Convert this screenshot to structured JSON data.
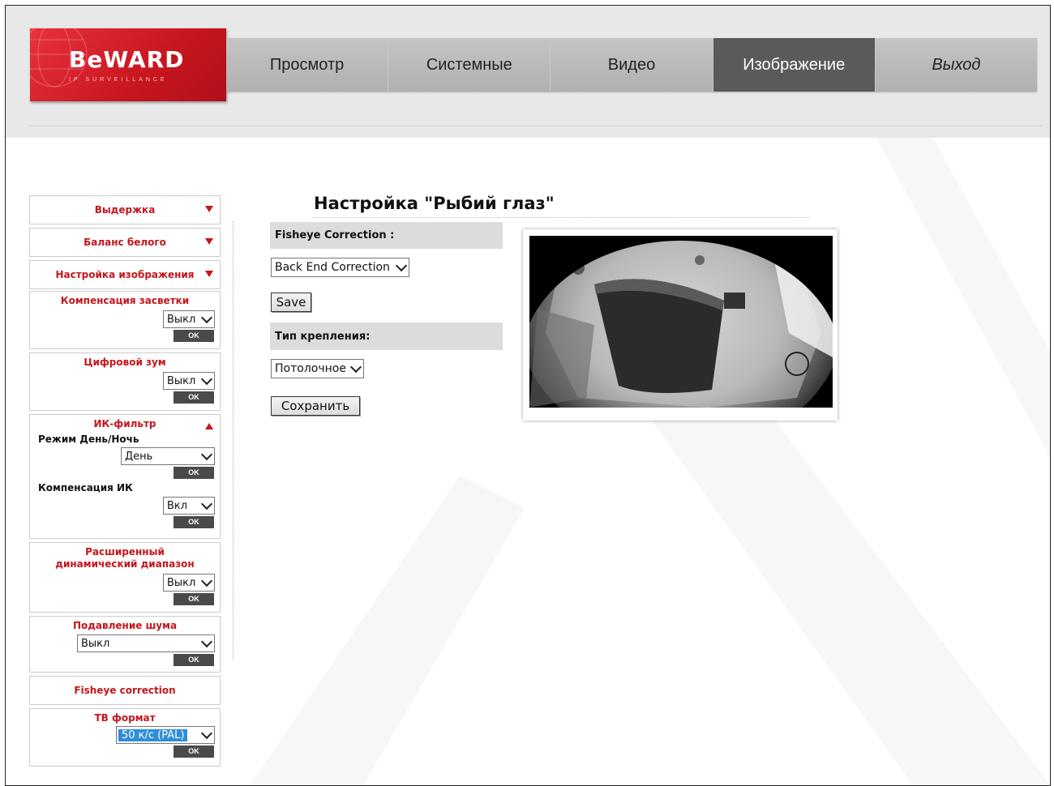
{
  "logo": {
    "brand": "BeWARD",
    "tagline": "IP SURVEILLANCE"
  },
  "nav": {
    "items": [
      {
        "label": "Просмотр",
        "active": false
      },
      {
        "label": "Системные",
        "active": false
      },
      {
        "label": "Видео",
        "active": false
      },
      {
        "label": "Изображение",
        "active": true
      },
      {
        "label": "Выход",
        "active": false
      }
    ]
  },
  "sidebar": {
    "exposure": "Выдержка",
    "white_balance": "Баланс белого",
    "image_settings": "Настройка изображения",
    "backlight": {
      "title": "Компенсация засветки",
      "value": "Выкл",
      "ok": "OK"
    },
    "digital_zoom": {
      "title": "Цифровой зум",
      "value": "Выкл",
      "ok": "OK"
    },
    "ir_filter": {
      "title": "ИК-фильтр",
      "day_night_label": "Режим День/Ночь",
      "day_night_value": "День",
      "ok1": "OK",
      "ir_comp_label": "Компенсация ИК",
      "ir_comp_value": "Вкл",
      "ok2": "OK"
    },
    "wdr": {
      "title": "Расширенный динамический диапазон",
      "value": "Выкл",
      "ok": "OK"
    },
    "noise": {
      "title": "Подавление шума",
      "value": "Выкл",
      "ok": "OK"
    },
    "fisheye": "Fisheye correction",
    "tv_format": {
      "title": "ТВ формат",
      "value": "50 к/с (PAL)",
      "ok": "OK"
    }
  },
  "content": {
    "title": "Настройка \"Рыбий глаз\"",
    "fisheye_correction_label": "Fisheye Correction :",
    "fisheye_correction_value": "Back End Correction",
    "save_label": "Save",
    "mount_label": "Тип крепления:",
    "mount_value": "Потолочное",
    "save_ru_label": "Сохранить"
  },
  "colors": {
    "brand_red": "#c4161c",
    "nav_active": "#5a5a5a",
    "selected_option": "#2f8ed8"
  }
}
